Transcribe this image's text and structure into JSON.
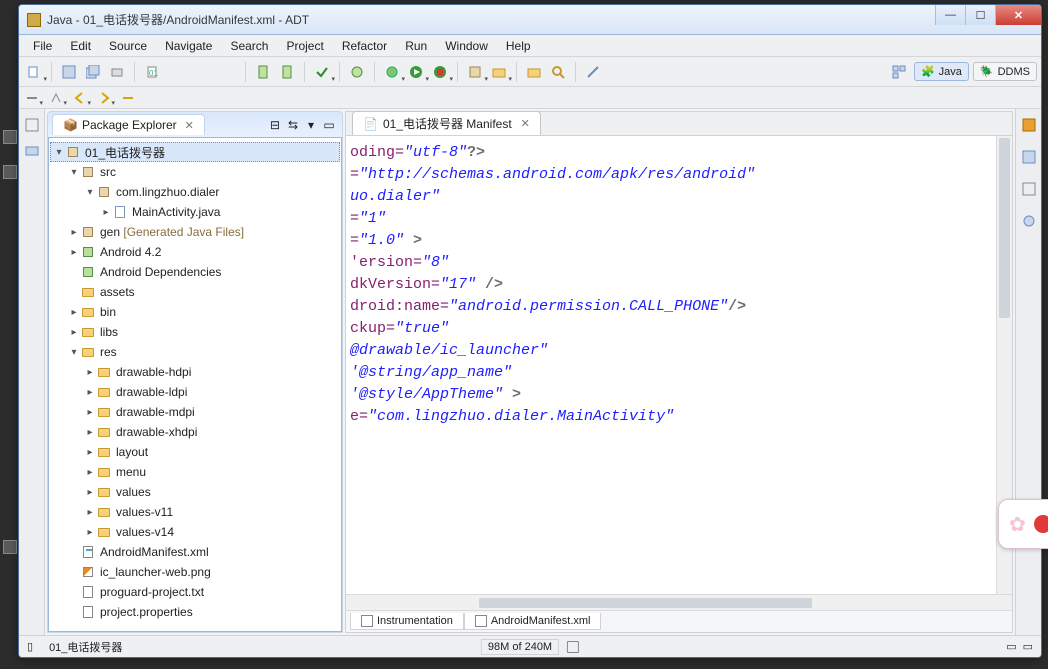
{
  "window": {
    "title_prefix": "Java - 01_电话拨号器/AndroidManifest.xml - ADT"
  },
  "menus": [
    "File",
    "Edit",
    "Source",
    "Navigate",
    "Search",
    "Project",
    "Refactor",
    "Run",
    "Window",
    "Help"
  ],
  "perspectives": {
    "java_label": "Java",
    "ddms_label": "DDMS"
  },
  "explorer": {
    "title": "Package Explorer",
    "project": "01_电话拨号器",
    "src": "src",
    "package": "com.lingzhuo.dialer",
    "main_activity": "MainActivity.java",
    "gen_label": "gen",
    "gen_suffix": " [Generated Java Files]",
    "android_lib": "Android 4.2",
    "android_deps": "Android Dependencies",
    "assets": "assets",
    "bin": "bin",
    "libs": "libs",
    "res": "res",
    "res_folders": [
      "drawable-hdpi",
      "drawable-ldpi",
      "drawable-mdpi",
      "drawable-xhdpi",
      "layout",
      "menu",
      "values",
      "values-v11",
      "values-v14"
    ],
    "files": {
      "manifest": "AndroidManifest.xml",
      "launcher": "ic_launcher-web.png",
      "proguard": "proguard-project.txt",
      "props": "project.properties"
    }
  },
  "editor": {
    "tab_label": "01_电话拨号器 Manifest",
    "bottom_tabs": {
      "instr": "Instrumentation",
      "xml": "AndroidManifest.xml"
    },
    "code": {
      "l1_a": "oding=",
      "l1_b": "\"utf-8\"",
      "l1_c": "?>",
      "l2_a": "=",
      "l2_b": "\"http://schemas.android.com/apk/res/android\"",
      "l3_a": "uo.dialer\"",
      "l4_a": "=",
      "l4_b": "\"1\"",
      "l5_a": "=",
      "l5_b": "\"1.0\"",
      "l5_c": " >",
      "l6": "",
      "l7_a": "'ersion=",
      "l7_b": "\"8\"",
      "l8_a": "dkVersion=",
      "l8_b": "\"17\"",
      "l8_c": " />",
      "l9_a": "droid:name",
      "l9_b": "=",
      "l9_c": "\"android.permission.CALL_PHONE\"",
      "l9_d": "/>",
      "l10": "",
      "l11": "",
      "l12_a": "ckup=",
      "l12_b": "\"true\"",
      "l13_a": "@drawable/ic_launcher\"",
      "l14_a": "'@string/app_name\"",
      "l15_a": "'@style/AppTheme\"",
      "l15_b": " >",
      "l16": "",
      "l17_a": "e=",
      "l17_b": "\"com.lingzhuo.dialer.MainActivity\""
    }
  },
  "status": {
    "left_icon_label": " ",
    "project_label": "01_电话拨号器",
    "heap": "98M of 240M"
  }
}
